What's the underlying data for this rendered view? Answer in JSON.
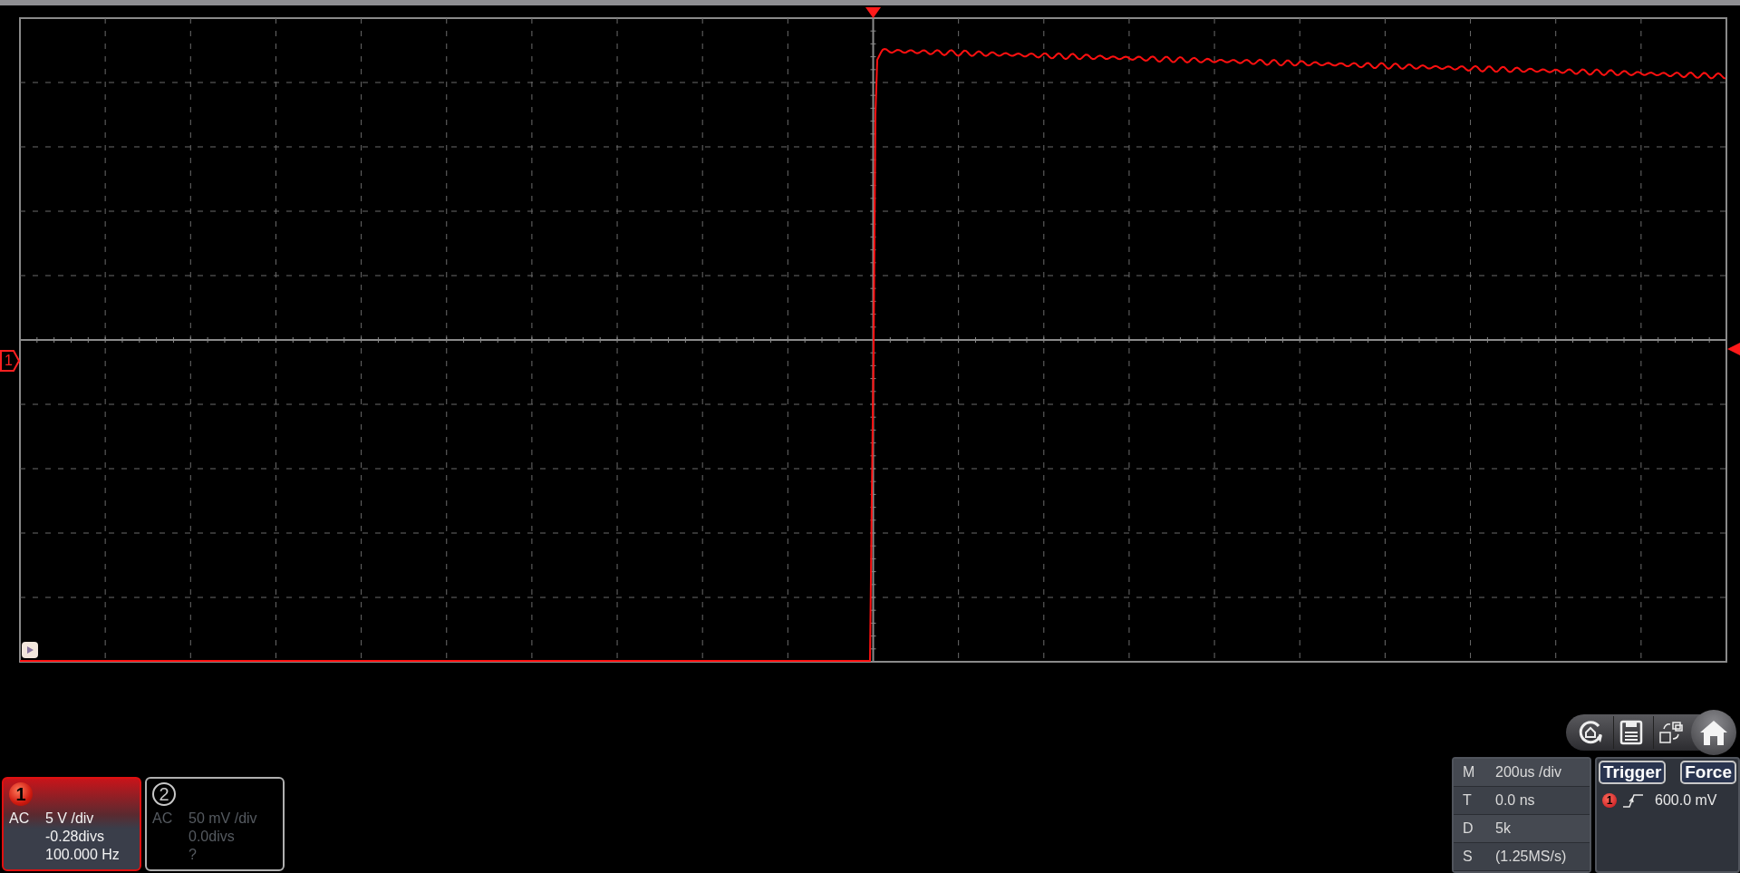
{
  "channel_marker": {
    "label": "1"
  },
  "channels": [
    {
      "number": "1",
      "coupling": "AC",
      "scale": "5 V /div",
      "offset": "-0.28divs",
      "frequency": "100.000 Hz",
      "active": true
    },
    {
      "number": "2",
      "coupling": "AC",
      "scale": "50 mV /div",
      "offset": "0.0divs",
      "frequency": "?",
      "active": false
    }
  ],
  "timebase": [
    {
      "label": "M",
      "value": "200us /div"
    },
    {
      "label": "T",
      "value": "0.0 ns"
    },
    {
      "label": "D",
      "value": "5k"
    },
    {
      "label": "S",
      "value": "(1.25MS/s)"
    }
  ],
  "trigger": {
    "title": "Trigger",
    "force": "Force",
    "source": "1",
    "voltage": "600.0 mV"
  }
}
